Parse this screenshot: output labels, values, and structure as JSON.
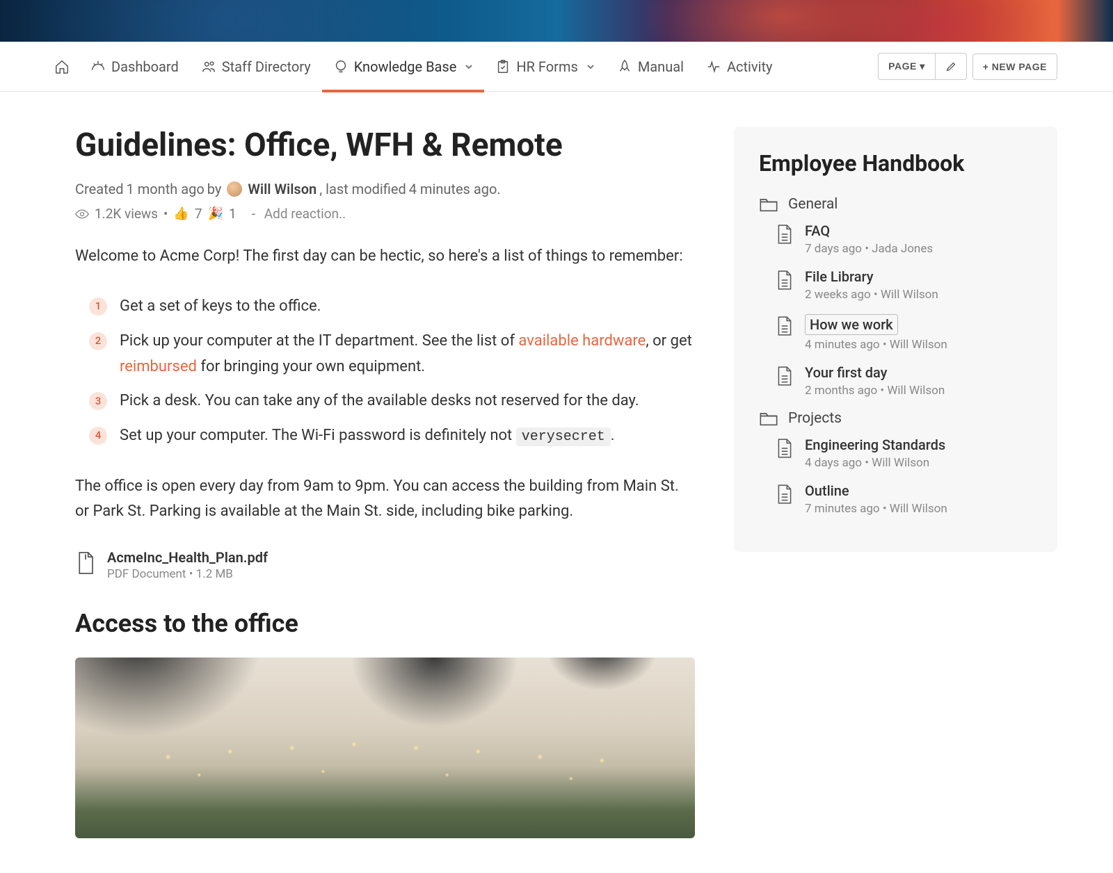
{
  "nav": {
    "items": [
      {
        "label": "Dashboard"
      },
      {
        "label": "Staff Directory"
      },
      {
        "label": "Knowledge Base"
      },
      {
        "label": "HR Forms"
      },
      {
        "label": "Manual"
      },
      {
        "label": "Activity"
      }
    ],
    "page_btn": "PAGE ▾",
    "new_page_btn": "+ NEW PAGE"
  },
  "page": {
    "title": "Guidelines: Office, WFH & Remote",
    "created_prefix": "Created ",
    "created_time": "1 month ago",
    "created_by": " by ",
    "author": "Will Wilson",
    "modified_prefix": ", last modified ",
    "modified_time": "4 minutes ago.",
    "views": "1.2K views",
    "bullet1": " • ",
    "thumbs_count": "7",
    "party_count": "1",
    "dash": "   - ",
    "add_reaction": "Add reaction..",
    "intro": "Welcome to Acme Corp! The first day can be hectic, so here's a list of things to remember:",
    "list": [
      {
        "num": "1",
        "text": "Get a set of keys to the office."
      },
      {
        "num": "2",
        "before1": "Pick up your computer at the IT department. See the list of ",
        "link1": "available hardware",
        "mid": ", or get ",
        "link2": "reimbursed",
        "after": " for bringing your own equipment."
      },
      {
        "num": "3",
        "text": "Pick a desk. You can take any of the available desks not reserved for the day."
      },
      {
        "num": "4",
        "before1": "Set up your computer. The Wi-Fi password is definitely not ",
        "code": "verysecret",
        "after": "."
      }
    ],
    "hours_para": "The office is open every day from 9am to 9pm. You can access the building from Main St. or Park St. Parking is available at the Main St. side, including bike parking.",
    "attachment": {
      "name": "AcmeInc_Health_Plan.pdf",
      "meta": "PDF Document • 1.2 MB"
    },
    "section_heading": "Access to the office"
  },
  "sidebar": {
    "title": "Employee Handbook",
    "folders": [
      {
        "name": "General",
        "docs": [
          {
            "name": "FAQ",
            "meta": "7 days ago • Jada Jones"
          },
          {
            "name": "File Library",
            "meta": "2 weeks ago • Will Wilson"
          },
          {
            "name": "How we work",
            "meta": "4 minutes ago • Will Wilson",
            "active": true
          },
          {
            "name": "Your first day",
            "meta": "2 months ago • Will Wilson"
          }
        ]
      },
      {
        "name": "Projects",
        "docs": [
          {
            "name": "Engineering Standards",
            "meta": "4 days ago • Will Wilson"
          },
          {
            "name": "Outline",
            "meta": "7 minutes ago • Will Wilson"
          }
        ]
      }
    ]
  }
}
